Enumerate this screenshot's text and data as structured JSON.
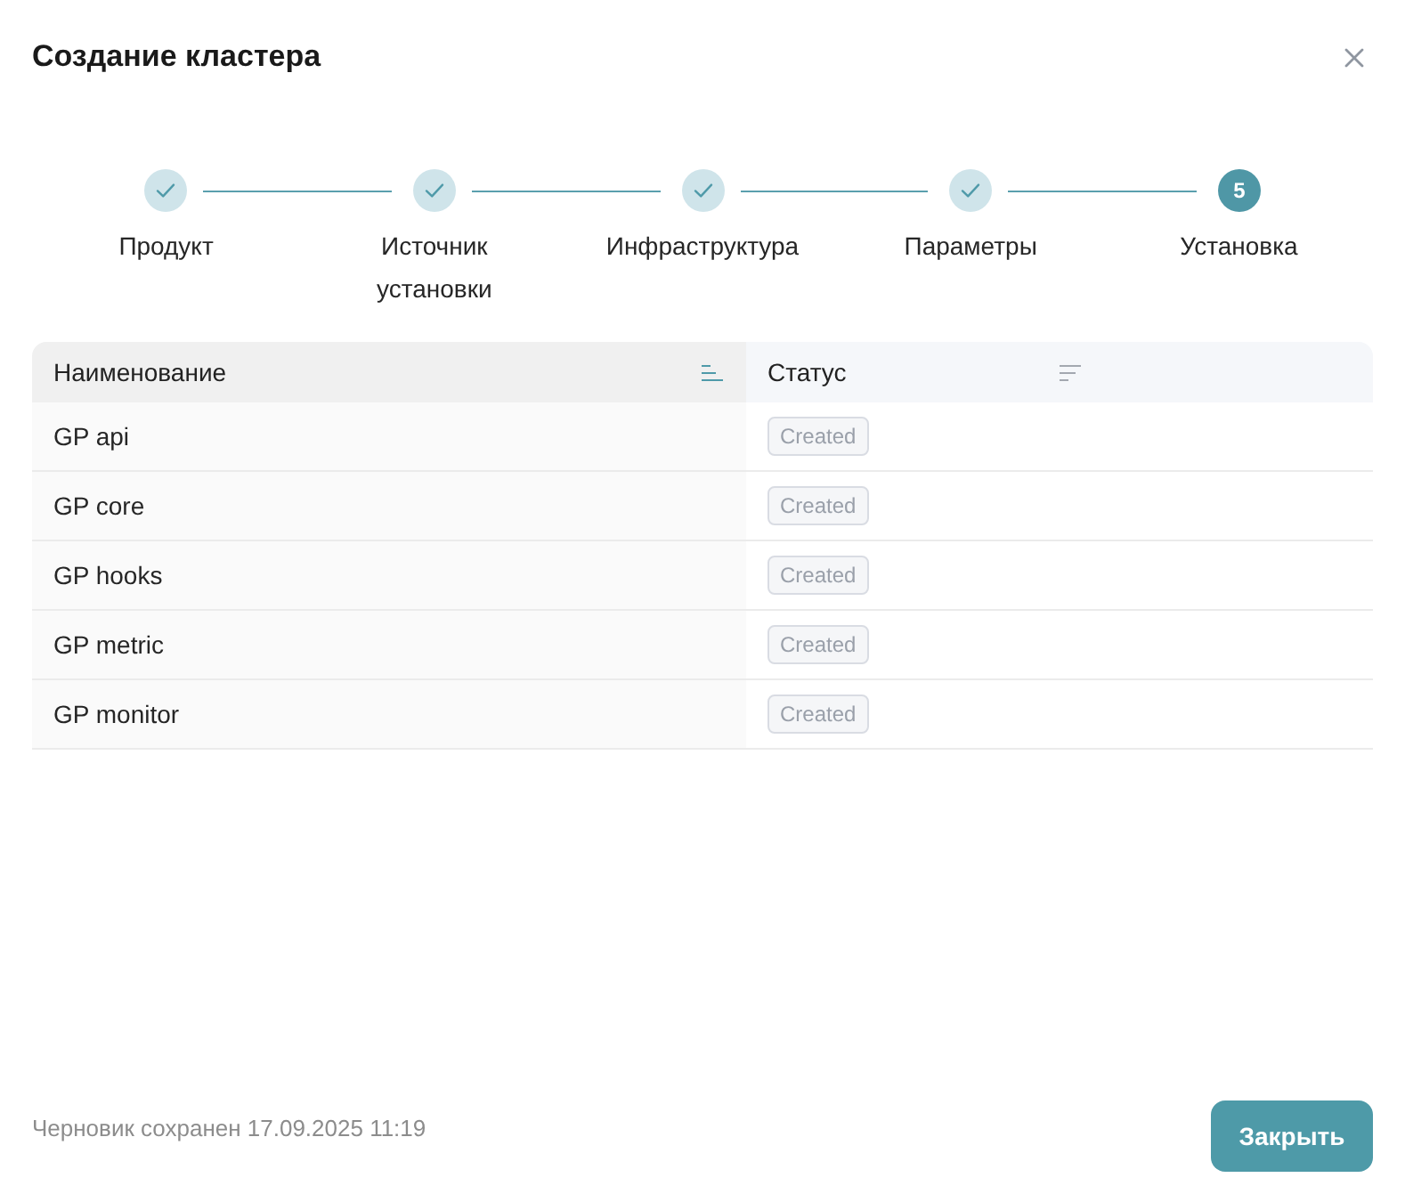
{
  "dialog": {
    "title": "Создание кластера"
  },
  "steps": [
    {
      "label": "Продукт",
      "completed": true
    },
    {
      "label": "Источник установки",
      "completed": true
    },
    {
      "label": "Инфраструктура",
      "completed": true
    },
    {
      "label": "Параметры",
      "completed": true
    },
    {
      "label": "Установка",
      "completed": false,
      "number": "5"
    }
  ],
  "table": {
    "columns": [
      {
        "label": "Наименование",
        "sorted": true
      },
      {
        "label": "Статус",
        "sorted": false
      }
    ],
    "rows": [
      {
        "name": "GP api",
        "status": "Created"
      },
      {
        "name": "GP core",
        "status": "Created"
      },
      {
        "name": "GP hooks",
        "status": "Created"
      },
      {
        "name": "GP metric",
        "status": "Created"
      },
      {
        "name": "GP monitor",
        "status": "Created"
      }
    ]
  },
  "footer": {
    "draft_note": "Черновик сохранен 17.09.2025 11:19",
    "close_button": "Закрыть"
  }
}
